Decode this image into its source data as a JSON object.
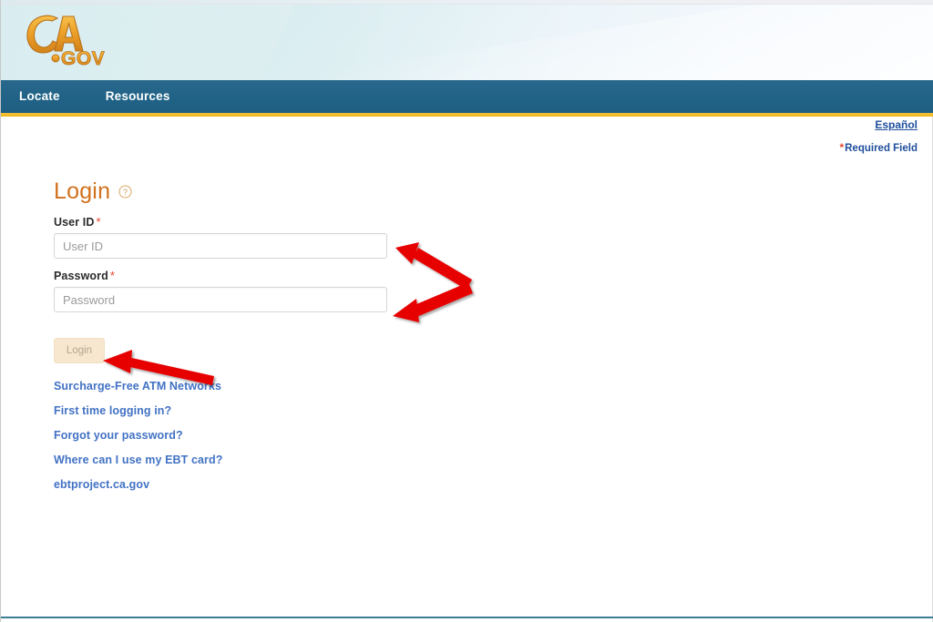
{
  "header": {
    "logo_alt": "CA.gov",
    "logo_text_ca": "CA",
    "logo_text_gov": ".GOV",
    "nav": [
      {
        "label": "Locate",
        "name": "nav-item-locate"
      },
      {
        "label": "Resources",
        "name": "nav-item-resources"
      }
    ],
    "espanol_label": "Español",
    "required_field_star": "*",
    "required_field_label": "Required Field"
  },
  "login": {
    "title": "Login",
    "help_icon": "question-mark-circle-icon",
    "userid": {
      "label": "User ID",
      "required_star": "*",
      "placeholder": "User ID",
      "value": ""
    },
    "password": {
      "label": "Password",
      "required_star": "*",
      "placeholder": "Password",
      "value": ""
    },
    "submit_label": "Login"
  },
  "links": [
    {
      "label": "Surcharge-Free ATM Networks",
      "name": "link-surcharge-free-atm-networks"
    },
    {
      "label": "First time logging in?",
      "name": "link-first-time-logging-in"
    },
    {
      "label": "Forgot your password?",
      "name": "link-forgot-your-password"
    },
    {
      "label": "Where can I use my EBT card?",
      "name": "link-where-can-i-use-my-ebt-card"
    },
    {
      "label": "ebtproject.ca.gov",
      "name": "link-ebtproject-ca-gov"
    }
  ],
  "annotations": [
    {
      "name": "annotation-arrow-to-userid-and-password",
      "color": "#e60000",
      "shape": "double-headed-arrow"
    },
    {
      "name": "annotation-arrow-to-login-button",
      "color": "#e60000",
      "shape": "single-arrow-left"
    }
  ],
  "colors": {
    "nav_bar": "#236589",
    "nav_accent": "#f0b823",
    "brand_orange": "#d1711c",
    "link_blue": "#4272c4",
    "espanol_blue": "#1f4e9c",
    "required_red": "#e8442a",
    "annotation_red": "#e60000",
    "bottom_rule": "#3f7e92"
  }
}
